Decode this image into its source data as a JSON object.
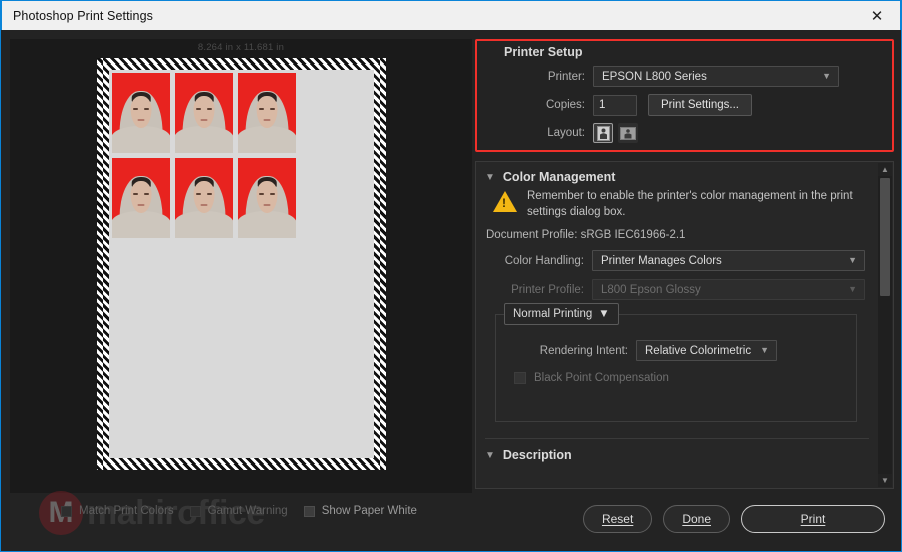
{
  "window": {
    "title": "Photoshop Print Settings",
    "close_icon": "close-icon"
  },
  "preview": {
    "dimensions_label": "8.264 in x 11.681 in",
    "photo_count": 6,
    "photo_background": "#e8231f"
  },
  "printer_setup": {
    "group_title": "Printer Setup",
    "highlight_color": "#f0302a",
    "printer_label": "Printer:",
    "printer_value": "EPSON L800 Series",
    "copies_label": "Copies:",
    "copies_value": "1",
    "print_settings_button": "Print Settings...",
    "layout_label": "Layout:",
    "layout_portrait_icon": "layout-portrait-icon",
    "layout_landscape_icon": "layout-landscape-icon"
  },
  "color_management": {
    "section_title": "Color Management",
    "disclosure_icon": "chevron-down-icon",
    "warning_icon": "warning-triangle-icon",
    "warning_text": "Remember to enable the printer's color management in the print settings dialog box.",
    "document_profile": "Document Profile: sRGB IEC61966-2.1",
    "color_handling_label": "Color Handling:",
    "color_handling_value": "Printer Manages Colors",
    "printer_profile_label": "Printer Profile:",
    "printer_profile_value": "L800 Epson Glossy",
    "print_mode_value": "Normal Printing",
    "rendering_intent_label": "Rendering Intent:",
    "rendering_intent_value": "Relative Colorimetric",
    "black_point_label": "Black Point Compensation",
    "black_point_checked": false
  },
  "description": {
    "section_title": "Description",
    "disclosure_icon": "chevron-down-icon"
  },
  "scrollbar": {
    "up_arrow_icon": "chevron-up-icon",
    "down_arrow_icon": "chevron-down-icon"
  },
  "bottom_bar": {
    "match_print_colors_label": "Match Print Colors",
    "gamut_warning_label": "Gamut Warning",
    "show_paper_white_label": "Show Paper White",
    "reset_button": "Reset",
    "done_button": "Done",
    "print_button": "Print"
  },
  "watermark": {
    "mark": "M",
    "text": "mahiroffice"
  }
}
